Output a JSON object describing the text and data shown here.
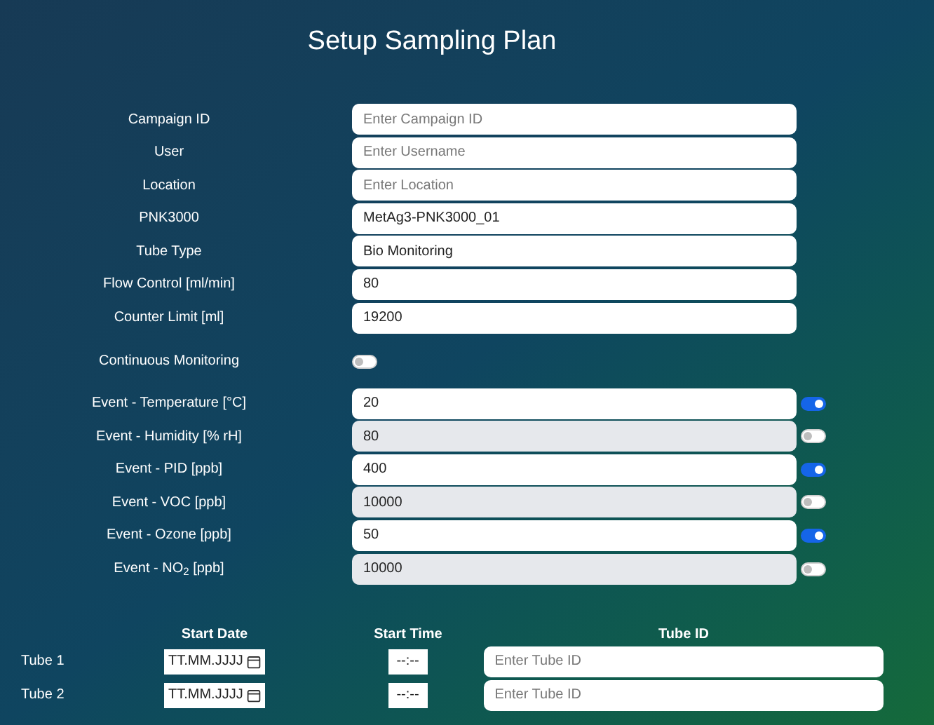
{
  "title": "Setup Sampling Plan",
  "fields": [
    {
      "label": "Campaign ID",
      "placeholder": "Enter Campaign ID"
    },
    {
      "label": "User",
      "placeholder": "Enter Username"
    },
    {
      "label": "Location",
      "placeholder": "Enter Location"
    },
    {
      "label": "PNK3000",
      "value": "MetAg3-PNK3000_01"
    },
    {
      "label": "Tube Type",
      "value": "Bio Monitoring"
    },
    {
      "label": "Flow Control [ml/min]",
      "value": "80"
    },
    {
      "label": "Counter Limit [ml]",
      "value": "19200"
    }
  ],
  "continuous_monitoring": {
    "label": "Continuous Monitoring",
    "on": false
  },
  "events": [
    {
      "label": "Event - Temperature [°C]",
      "value": "20",
      "on": true
    },
    {
      "label": "Event - Humidity [% rH]",
      "value": "80",
      "on": false
    },
    {
      "label": "Event - PID [ppb]",
      "value": "400",
      "on": true
    },
    {
      "label": "Event - VOC [ppb]",
      "value": "10000",
      "on": false
    },
    {
      "label": "Event - Ozone [ppb]",
      "value": "50",
      "on": true
    },
    {
      "label": "Event - NO$_{2}$ [ppb]",
      "value": "10000",
      "on": false
    }
  ],
  "tubes": {
    "columns": [
      "Start Date",
      "Start Time",
      "Tube ID"
    ],
    "rows": [
      {
        "label": "Tube 1",
        "date": "TT.MM.JJJJ",
        "time": "--:--",
        "placeholder": "Enter Tube ID"
      },
      {
        "label": "Tube 2",
        "date": "TT.MM.JJJJ",
        "time": "--:--",
        "placeholder": "Enter Tube ID"
      }
    ]
  }
}
